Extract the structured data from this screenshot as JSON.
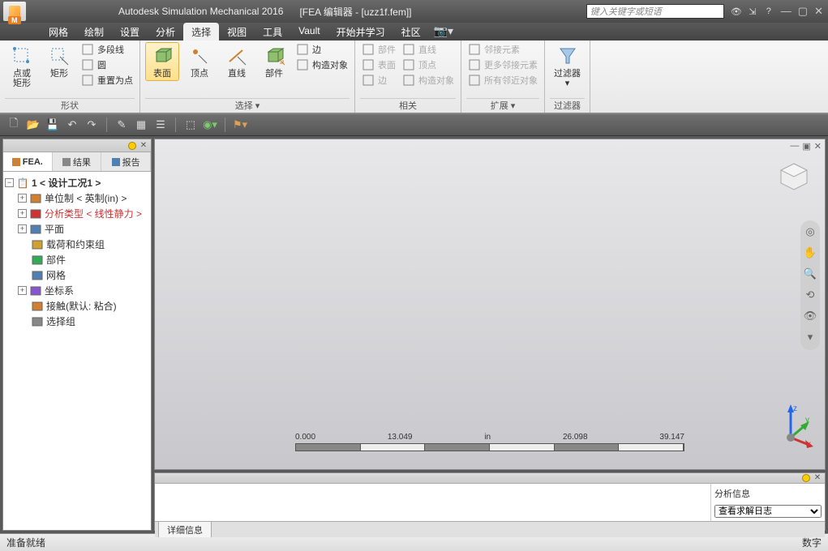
{
  "title": {
    "app": "Autodesk Simulation Mechanical 2016",
    "doc": "[FEA 编辑器 - [uzz1f.fem]]",
    "logo_badge": "M",
    "search_placeholder": "键入关键字或短语"
  },
  "menu": {
    "items": [
      "网格",
      "绘制",
      "设置",
      "分析",
      "选择",
      "视图",
      "工具",
      "Vault",
      "开始并学习",
      "社区"
    ],
    "active_index": 4
  },
  "ribbon": {
    "groups": [
      {
        "title": "形状",
        "big": [
          {
            "label": "点或\n矩形",
            "icon": "point-rect"
          },
          {
            "label": "矩形",
            "icon": "rect-cursor"
          }
        ],
        "small": [
          {
            "label": "多段线",
            "icon": "polyline"
          },
          {
            "label": "圆",
            "icon": "circle"
          },
          {
            "label": "重置为点",
            "icon": "reset-point"
          }
        ]
      },
      {
        "title": "选择 ▾",
        "big": [
          {
            "label": "表面",
            "icon": "cube",
            "active": true
          },
          {
            "label": "顶点",
            "icon": "vertex"
          },
          {
            "label": "直线",
            "icon": "line"
          },
          {
            "label": "部件",
            "icon": "cube-cursor"
          }
        ],
        "small": [
          {
            "label": "边",
            "icon": "edge"
          },
          {
            "label": "构造对象",
            "icon": "construct"
          }
        ]
      },
      {
        "title": "相关",
        "disabled": true,
        "small_cols": [
          [
            {
              "label": "部件"
            },
            {
              "label": "表面"
            },
            {
              "label": "边"
            }
          ],
          [
            {
              "label": "直线"
            },
            {
              "label": "顶点"
            },
            {
              "label": "构造对象"
            }
          ]
        ]
      },
      {
        "title": "扩展 ▾",
        "disabled": true,
        "small": [
          {
            "label": "邻接元素"
          },
          {
            "label": "更多邻接元素"
          },
          {
            "label": "所有邻近对象"
          }
        ]
      },
      {
        "title": "过滤器",
        "big": [
          {
            "label": "过滤器",
            "icon": "funnel",
            "dropdown": true
          }
        ]
      }
    ]
  },
  "left_panel": {
    "tabs": [
      "FEA.",
      "结果",
      "报告"
    ],
    "active_tab": 0,
    "tree": {
      "root": "1 < 设计工况1 >",
      "children": [
        {
          "label": "单位制 < 英制(in) >",
          "expandable": true,
          "color": "#333"
        },
        {
          "label": "分析类型 < 线性静力 >",
          "expandable": true,
          "color": "#cc3333"
        },
        {
          "label": "平面",
          "expandable": true,
          "color": "#333"
        },
        {
          "label": "载荷和约束组",
          "expandable": false,
          "color": "#333"
        },
        {
          "label": "部件",
          "expandable": false,
          "color": "#333"
        },
        {
          "label": "网格",
          "expandable": false,
          "color": "#333"
        },
        {
          "label": "坐标系",
          "expandable": true,
          "color": "#333"
        },
        {
          "label": "接触(默认: 粘合)",
          "expandable": false,
          "color": "#333"
        },
        {
          "label": "选择组",
          "expandable": false,
          "color": "#333"
        }
      ]
    }
  },
  "viewport": {
    "ruler": {
      "values": [
        "0.000",
        "13.049",
        "in",
        "26.098",
        "39.147"
      ]
    }
  },
  "bottom_panel": {
    "analysis_label": "分析信息",
    "dropdown": "查看求解日志",
    "tab": "详细信息"
  },
  "status": {
    "left": "准备就绪",
    "right": "数字"
  }
}
